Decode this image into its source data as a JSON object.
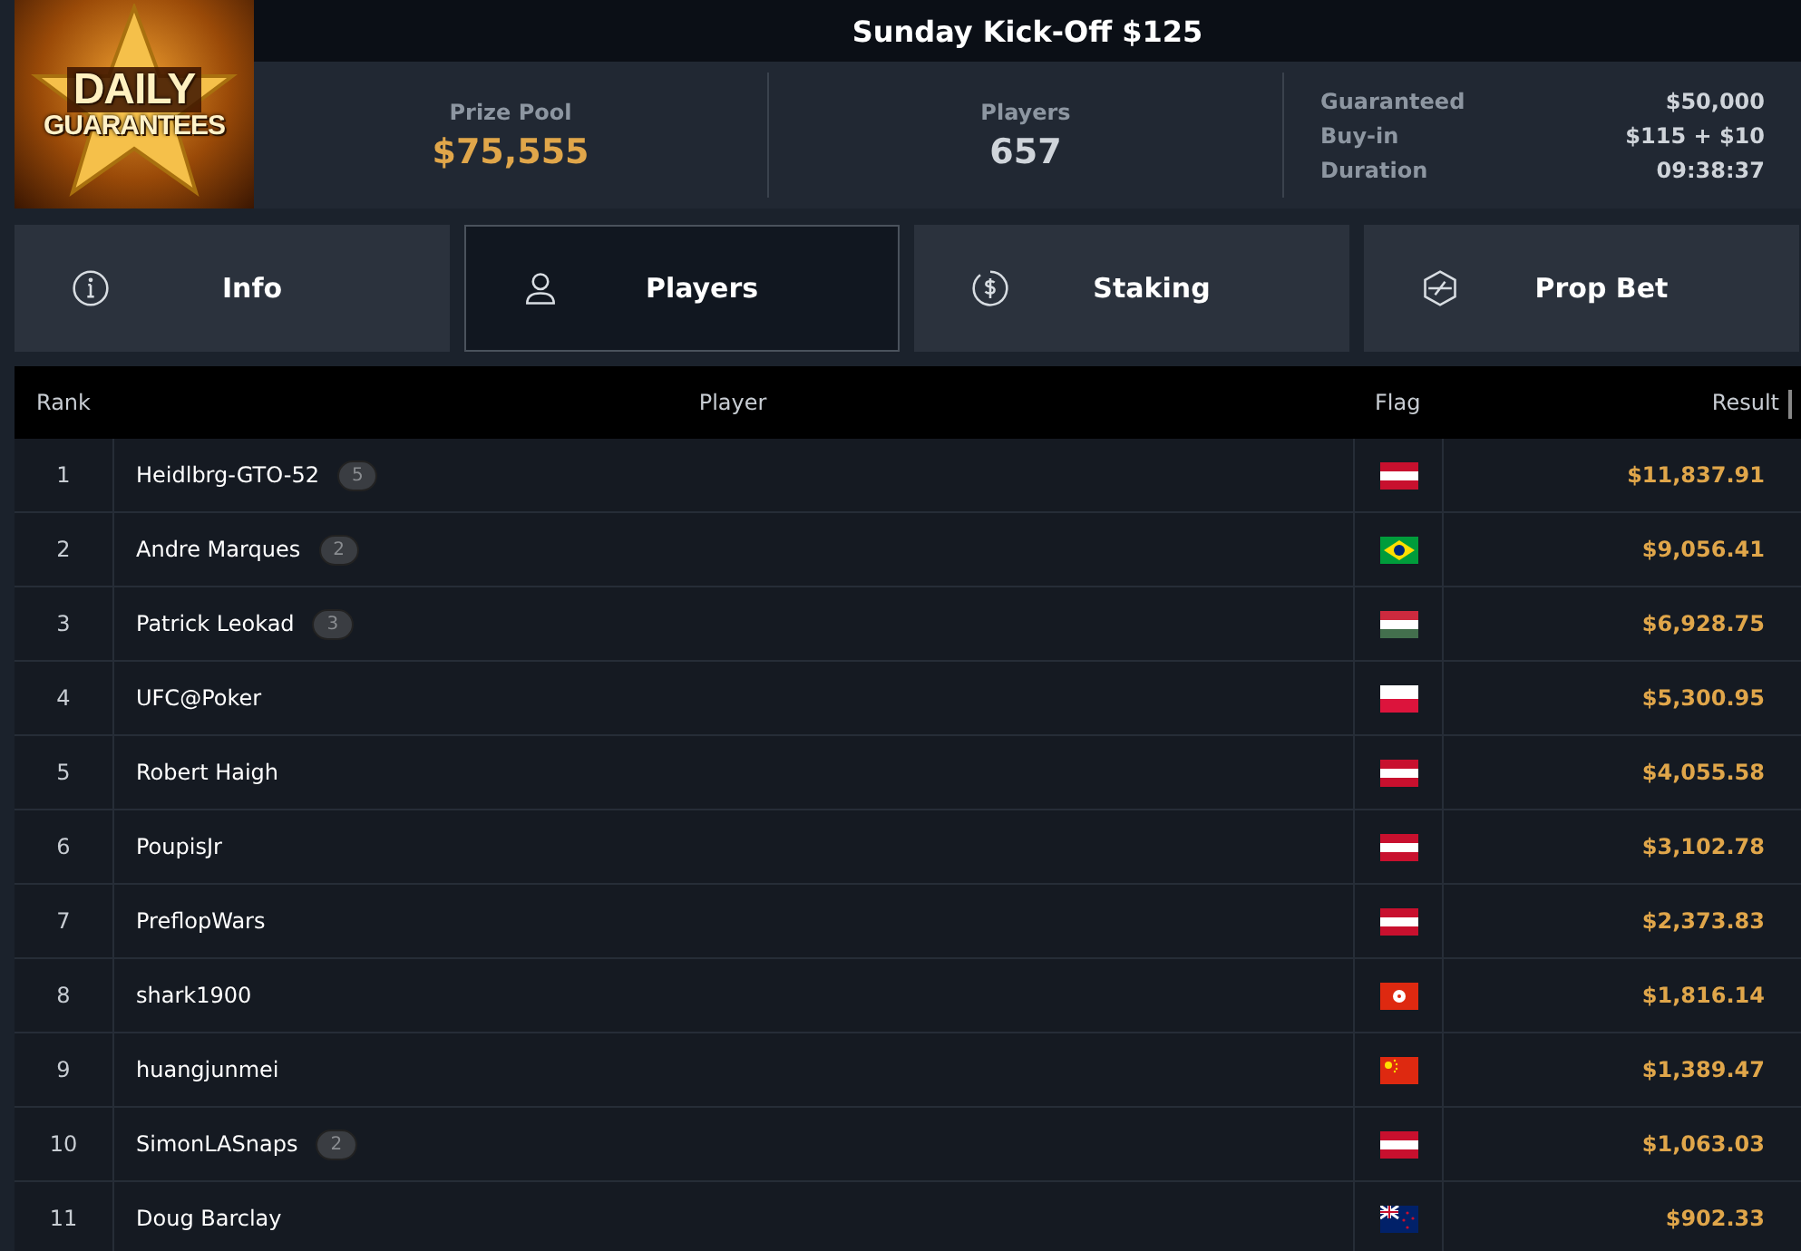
{
  "logo": {
    "line1": "DAILY",
    "line2": "GUARANTEES"
  },
  "title": "Sunday Kick-Off $125",
  "stats": [
    {
      "label": "Prize Pool",
      "value": "$75,555",
      "highlight": true
    },
    {
      "label": "Players",
      "value": "657",
      "highlight": false
    }
  ],
  "details": [
    {
      "label": "Guaranteed",
      "value": "$50,000"
    },
    {
      "label": "Buy-in",
      "value": "$115 + $10"
    },
    {
      "label": "Duration",
      "value": "09:38:37"
    }
  ],
  "tabs": [
    {
      "label": "Info",
      "kind": "info",
      "selected": false
    },
    {
      "label": "Players",
      "kind": "user",
      "selected": true
    },
    {
      "label": "Staking",
      "kind": "dollar",
      "selected": false
    },
    {
      "label": "Prop Bet",
      "kind": "bolt",
      "selected": false
    }
  ],
  "table": {
    "columns": [
      "Rank",
      "Player",
      "Flag",
      "Result"
    ],
    "rows": [
      {
        "rank": "1",
        "player": "Heidlbrg-GTO-52",
        "count": "5",
        "kind": "austria",
        "result": "$11,837.91"
      },
      {
        "rank": "2",
        "player": "Andre Marques",
        "count": "2",
        "kind": "brazil",
        "result": "$9,056.41"
      },
      {
        "rank": "3",
        "player": "Patrick Leokad",
        "count": "3",
        "kind": "hungary",
        "result": "$6,928.75"
      },
      {
        "rank": "4",
        "player": "UFC@Poker",
        "kind": "poland",
        "result": "$5,300.95"
      },
      {
        "rank": "5",
        "player": "Robert Haigh",
        "kind": "austria",
        "result": "$4,055.58"
      },
      {
        "rank": "6",
        "player": "PoupisJr",
        "kind": "austria",
        "result": "$3,102.78"
      },
      {
        "rank": "7",
        "player": "PreflopWars",
        "kind": "austria",
        "result": "$2,373.83"
      },
      {
        "rank": "8",
        "player": "shark1900",
        "kind": "hongkong",
        "result": "$1,816.14"
      },
      {
        "rank": "9",
        "player": "huangjunmei",
        "kind": "china",
        "result": "$1,389.47"
      },
      {
        "rank": "10",
        "player": "SimonLASnaps",
        "count": "2",
        "kind": "austria",
        "result": "$1,063.03"
      },
      {
        "rank": "11",
        "player": "Doug Barclay",
        "kind": "newzealand",
        "result": "$902.33"
      }
    ]
  }
}
